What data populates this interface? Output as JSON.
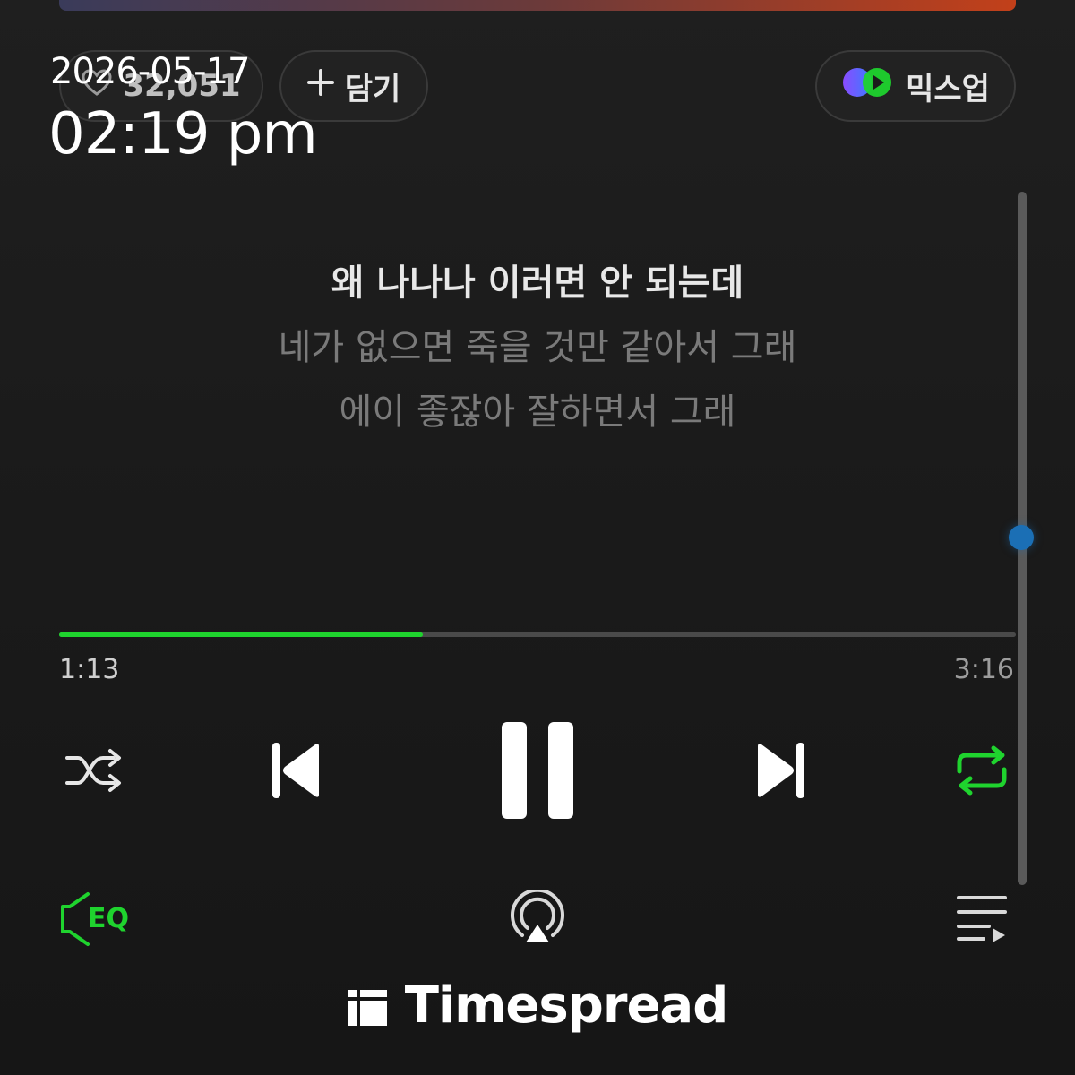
{
  "top_actions": {
    "like_count": "32,051",
    "add_label": "담기",
    "mixup_label": "믹스업"
  },
  "overlay": {
    "date": "2026-05-17",
    "time": "02:19 pm"
  },
  "lyrics": [
    {
      "text": "왜 나나나 이러면 안 되는데",
      "current": true
    },
    {
      "text": "네가 없으면 죽을 것만 같아서 그래",
      "current": false
    },
    {
      "text": "에이 좋잖아 잘하면서 그래",
      "current": false
    }
  ],
  "playback": {
    "elapsed": "1:13",
    "total": "3:16",
    "progress_fraction": 0.38,
    "state": "playing",
    "shuffle": false,
    "repeat": true
  },
  "bottom_bar": {
    "eq_label": "EQ"
  },
  "brand": {
    "name": "Timespread"
  },
  "colors": {
    "accent_green": "#1fd32e",
    "background": "#1b1b1b",
    "scroll_thumb": "#1b6fb5"
  },
  "icons": {
    "like": "heart-icon",
    "add": "plus-icon",
    "mixup": "mixup-icon",
    "shuffle": "shuffle-icon",
    "previous": "skip-previous-icon",
    "pause": "pause-icon",
    "next": "skip-next-icon",
    "repeat": "repeat-icon",
    "eq": "eq-icon",
    "airplay": "airplay-icon",
    "playlist": "playlist-icon"
  }
}
